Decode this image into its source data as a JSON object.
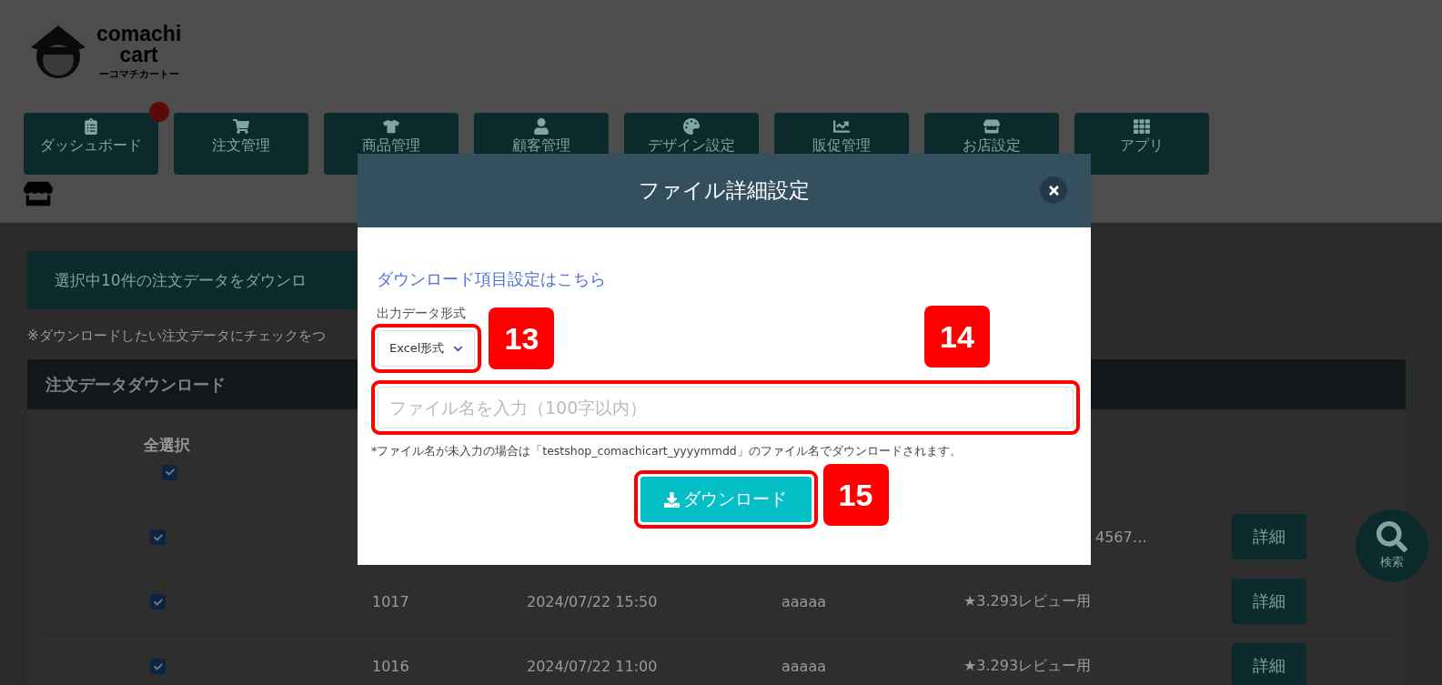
{
  "logo": {
    "line_1": "comachi",
    "line_2": "cart",
    "tagline": "ーコマチカートー"
  },
  "nav": [
    {
      "label": "ダッシュボード",
      "badge": true
    },
    {
      "label": "注文管理",
      "badge": false
    },
    {
      "label": "商品管理",
      "badge": false
    },
    {
      "label": "顧客管理",
      "badge": false
    },
    {
      "label": "デザイン設定",
      "badge": false
    },
    {
      "label": "販促管理",
      "badge": false
    },
    {
      "label": "お店設定",
      "badge": false
    },
    {
      "label": "アプリ",
      "badge": false
    }
  ],
  "download_selected_button": "選択中10件の注文データをダウンロ",
  "note": "※ダウンロードしたい注文データにチェックをつ",
  "table": {
    "title": "注文データダウンロード",
    "select_all": {
      "label": "全選択",
      "checked": true
    },
    "rows": [
      {
        "checked": true,
        "column_4": "4567…",
        "action": "詳細"
      },
      {
        "checked": true,
        "column_1": "1017",
        "column_2": "2024/07/22 15:50",
        "column_3": "aaaaa",
        "column_4": "★3.293レビュー用",
        "action": "詳細"
      },
      {
        "checked": true,
        "column_1": "1016",
        "column_2": "2024/07/22 11:00",
        "column_3": "aaaaa",
        "column_4": "★3.293レビュー用",
        "action": "詳細"
      }
    ]
  },
  "search_button": {
    "label": "検索"
  },
  "modal": {
    "title": "ファイル詳細設定",
    "link": "ダウンロード項目設定はこちら",
    "format_label": "出力データ形式",
    "format_select": {
      "value": "Excel形式"
    },
    "filename_field": {
      "placeholder": "ファイル名を入力（100字以内）"
    },
    "hint": "*ファイル名が未入力の場合は「testshop_comachicart_yyyymmdd」のファイル名でダウンロードされます。",
    "download_button": "ダウンロード"
  },
  "callouts": [
    {
      "number": "13"
    },
    {
      "number": "14"
    },
    {
      "number": "15"
    }
  ]
}
